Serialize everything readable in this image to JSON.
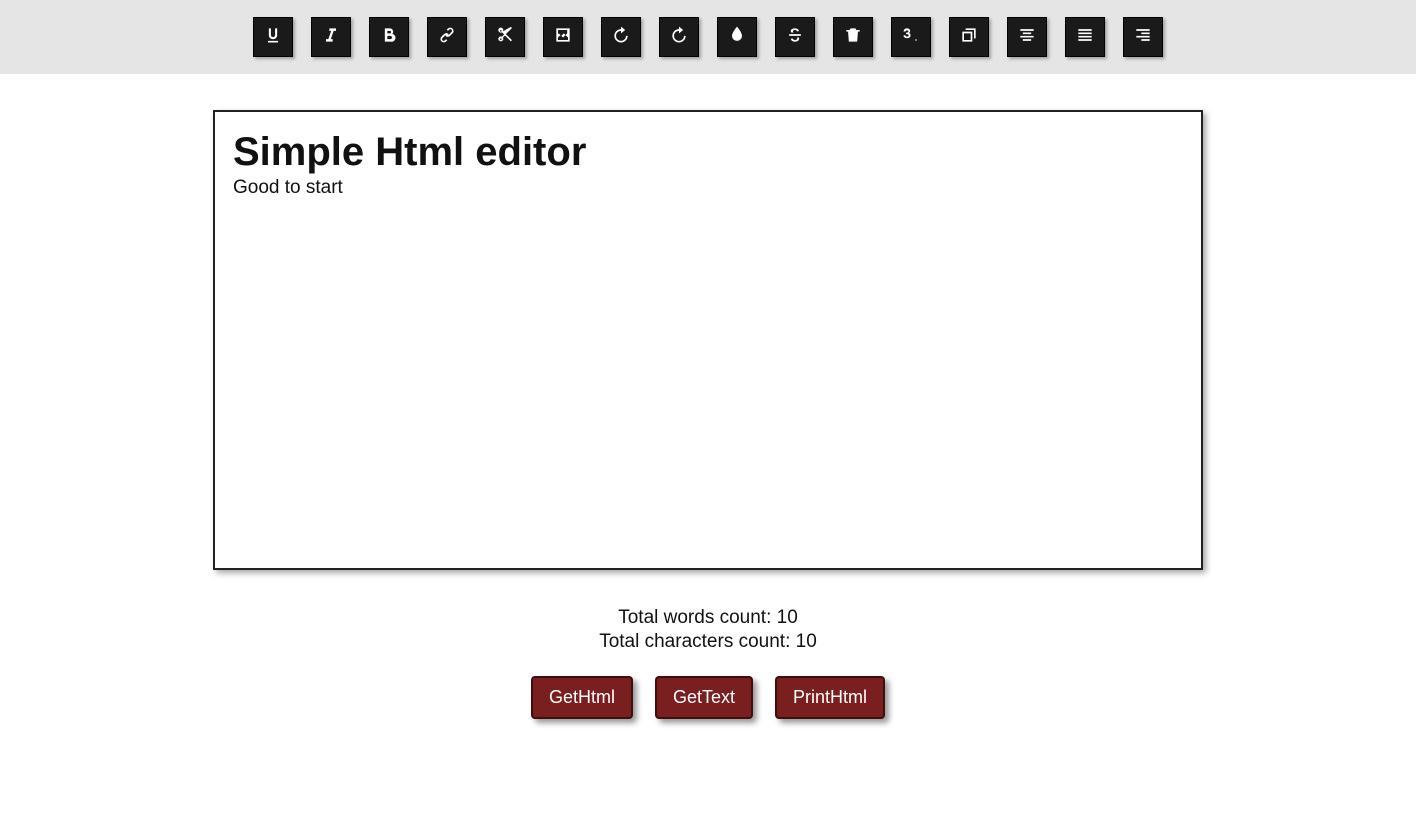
{
  "toolbar": {
    "buttons": [
      {
        "name": "underline-button",
        "icon": "underline"
      },
      {
        "name": "italic-button",
        "icon": "italic"
      },
      {
        "name": "bold-button",
        "icon": "bold"
      },
      {
        "name": "link-button",
        "icon": "link"
      },
      {
        "name": "cut-button",
        "icon": "scissors"
      },
      {
        "name": "image-button",
        "icon": "image"
      },
      {
        "name": "undo-button",
        "icon": "undo"
      },
      {
        "name": "redo-button",
        "icon": "redo"
      },
      {
        "name": "color-button",
        "icon": "tint"
      },
      {
        "name": "strikethrough-button",
        "icon": "strikethrough"
      },
      {
        "name": "delete-button",
        "icon": "trash"
      },
      {
        "name": "subscript-button",
        "icon": "subscript"
      },
      {
        "name": "copy-button",
        "icon": "copy"
      },
      {
        "name": "align-center-button",
        "icon": "align-center"
      },
      {
        "name": "align-left-button",
        "icon": "align-left"
      },
      {
        "name": "align-right-button",
        "icon": "align-right"
      }
    ]
  },
  "editor": {
    "heading": "Simple Html editor",
    "body": "Good to start"
  },
  "stats": {
    "words_label": "Total words count: ",
    "words_value": "10",
    "chars_label": "Total characters count: ",
    "chars_value": "10"
  },
  "actions": {
    "get_html": "GetHtml",
    "get_text": "GetText",
    "print_html": "PrintHtml"
  }
}
